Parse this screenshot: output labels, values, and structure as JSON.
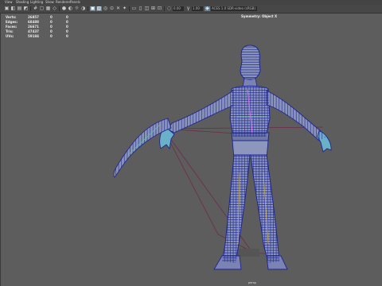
{
  "menubar": {
    "items": [
      {
        "label": "View"
      },
      {
        "label": "Shading"
      },
      {
        "label": "Lighting"
      },
      {
        "label": "Show"
      },
      {
        "label": "Renderer"
      },
      {
        "label": "Panels"
      }
    ]
  },
  "toolbar": {
    "icons": [
      "camera-icon",
      "camera-attributes-icon",
      "bookmark-icon",
      "image-plane-icon",
      "grid-icon",
      "frame-all-icon",
      "frame-selected-icon",
      "wireframe-icon",
      "smooth-shade-icon",
      "textured-icon",
      "lights-icon",
      "shadows-icon",
      "ambient-occlusion-icon",
      "anti-alias-icon",
      "dof-icon",
      "isolate-select-icon",
      "xray-icon",
      "xray-joints-icon",
      "backface-icon",
      "resolution-gate-icon",
      "gate-mask-icon",
      "field-chart-icon",
      "safe-action-icon",
      "safe-title-icon",
      "exposure-icon"
    ],
    "exposure_value": "0.00",
    "gamma_value": "1.00",
    "colorspace_value": "ACES 1.0 SDR-video (sRGB)"
  },
  "hud": {
    "rows": [
      {
        "label": "Verts:",
        "v1": "26857",
        "v2": "0",
        "v3": "0"
      },
      {
        "label": "Edges:",
        "v1": "68488",
        "v2": "0",
        "v3": "0"
      },
      {
        "label": "Faces:",
        "v1": "26671",
        "v2": "0",
        "v3": "0"
      },
      {
        "label": "Tris:",
        "v1": "47437",
        "v2": "0",
        "v3": "0"
      },
      {
        "label": "UVs:",
        "v1": "59184",
        "v2": "0",
        "v3": "0"
      }
    ]
  },
  "viewport": {
    "symmetry_label": "Symmetry: Object X",
    "camera_label": "persp"
  },
  "colors": {
    "background": "#5d5d5d",
    "wire": "#2a2f9a",
    "selection": "#b060e0"
  }
}
